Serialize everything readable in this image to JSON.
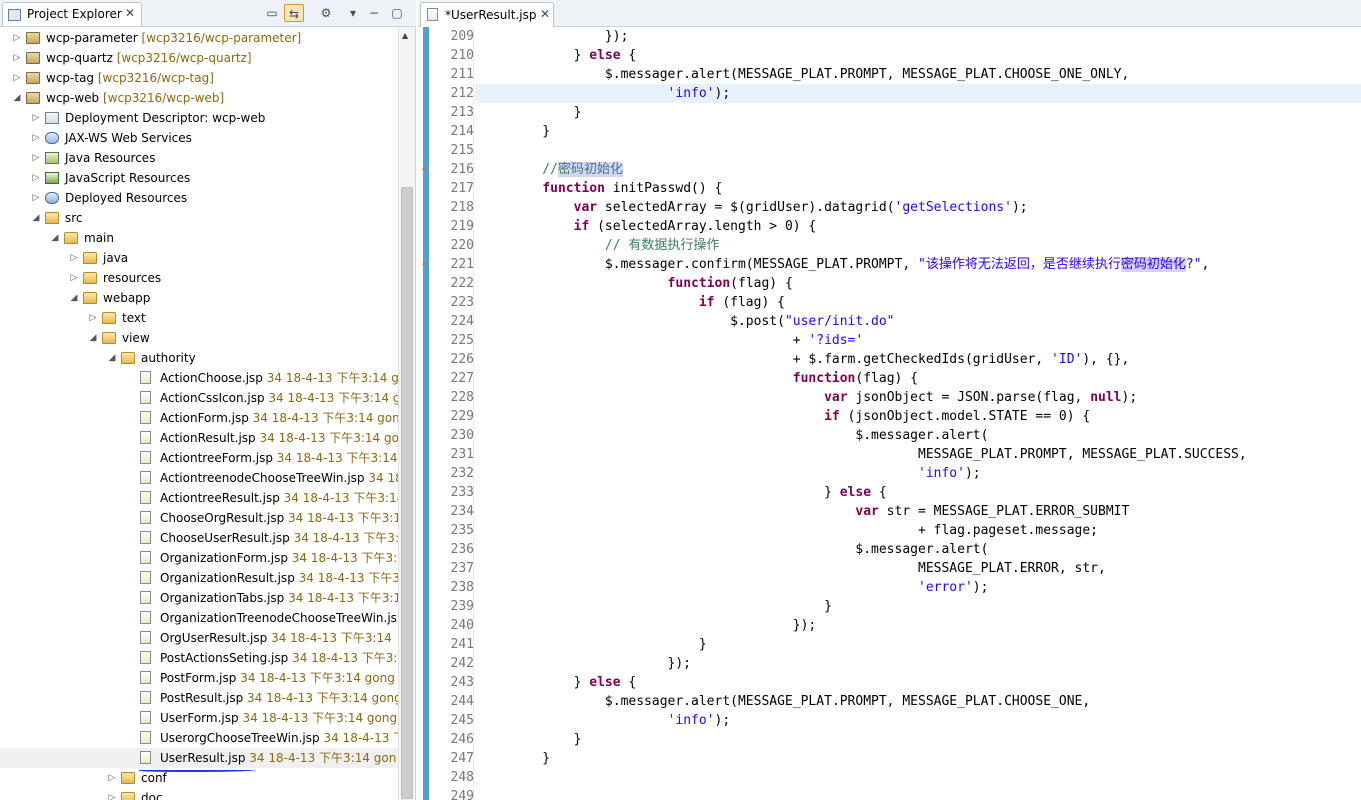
{
  "explorer": {
    "tab_title": "Project Explorer",
    "tab_close": "✕",
    "tools": [
      "▭",
      "⇆",
      "⚙",
      "▾",
      "−",
      "▢"
    ],
    "items": [
      {
        "depth": 0,
        "twisty": "▷",
        "icon": "project",
        "label": "wcp-parameter",
        "dec": "[wcp3216/wcp-parameter]"
      },
      {
        "depth": 0,
        "twisty": "▷",
        "icon": "project",
        "label": "wcp-quartz",
        "dec": "[wcp3216/wcp-quartz]"
      },
      {
        "depth": 0,
        "twisty": "▷",
        "icon": "project",
        "label": "wcp-tag",
        "dec": "[wcp3216/wcp-tag]"
      },
      {
        "depth": 0,
        "twisty": "◢",
        "icon": "project",
        "label": "wcp-web",
        "dec": "[wcp3216/wcp-web]"
      },
      {
        "depth": 1,
        "twisty": "▷",
        "icon": "desc",
        "label": "Deployment Descriptor: wcp-web",
        "dec": ""
      },
      {
        "depth": 1,
        "twisty": "▷",
        "icon": "ws",
        "label": "JAX-WS Web Services",
        "dec": ""
      },
      {
        "depth": 1,
        "twisty": "▷",
        "icon": "java",
        "label": "Java Resources",
        "dec": ""
      },
      {
        "depth": 1,
        "twisty": "▷",
        "icon": "js",
        "label": "JavaScript Resources",
        "dec": ""
      },
      {
        "depth": 1,
        "twisty": "▷",
        "icon": "deploy",
        "label": "Deployed Resources",
        "dec": ""
      },
      {
        "depth": 1,
        "twisty": "◢",
        "icon": "folder",
        "label": "src",
        "dec": ""
      },
      {
        "depth": 2,
        "twisty": "◢",
        "icon": "folder",
        "label": "main",
        "dec": ""
      },
      {
        "depth": 3,
        "twisty": "▷",
        "icon": "folder",
        "label": "java",
        "dec": ""
      },
      {
        "depth": 3,
        "twisty": "▷",
        "icon": "folder",
        "label": "resources",
        "dec": ""
      },
      {
        "depth": 3,
        "twisty": "◢",
        "icon": "folder",
        "label": "webapp",
        "dec": ""
      },
      {
        "depth": 4,
        "twisty": "▷",
        "icon": "folder",
        "label": "text",
        "dec": ""
      },
      {
        "depth": 4,
        "twisty": "◢",
        "icon": "folder",
        "label": "view",
        "dec": ""
      },
      {
        "depth": 5,
        "twisty": "◢",
        "icon": "folder",
        "label": "authority",
        "dec": ""
      },
      {
        "depth": 6,
        "twisty": "",
        "icon": "file",
        "label": "ActionChoose.jsp",
        "dec": "34  18-4-13 下午3:14  gong"
      },
      {
        "depth": 6,
        "twisty": "",
        "icon": "file",
        "label": "ActionCssIcon.jsp",
        "dec": "34  18-4-13 下午3:14  go"
      },
      {
        "depth": 6,
        "twisty": "",
        "icon": "file",
        "label": "ActionForm.jsp",
        "dec": "34  18-4-13 下午3:14  gong"
      },
      {
        "depth": 6,
        "twisty": "",
        "icon": "file",
        "label": "ActionResult.jsp",
        "dec": "34  18-4-13 下午3:14  gon"
      },
      {
        "depth": 6,
        "twisty": "",
        "icon": "file",
        "label": "ActiontreeForm.jsp",
        "dec": "34  18-4-13 下午3:14"
      },
      {
        "depth": 6,
        "twisty": "",
        "icon": "file",
        "label": "ActiontreenodeChooseTreeWin.jsp",
        "dec": "34  18-4"
      },
      {
        "depth": 6,
        "twisty": "",
        "icon": "file",
        "label": "ActiontreeResult.jsp",
        "dec": "34  18-4-13 下午3:14"
      },
      {
        "depth": 6,
        "twisty": "",
        "icon": "file",
        "label": "ChooseOrgResult.jsp",
        "dec": "34  18-4-13 下午3:14"
      },
      {
        "depth": 6,
        "twisty": "",
        "icon": "file",
        "label": "ChooseUserResult.jsp",
        "dec": "34  18-4-13 下午3:14"
      },
      {
        "depth": 6,
        "twisty": "",
        "icon": "file",
        "label": "OrganizationForm.jsp",
        "dec": "34  18-4-13 下午3:14"
      },
      {
        "depth": 6,
        "twisty": "",
        "icon": "file",
        "label": "OrganizationResult.jsp",
        "dec": "34  18-4-13 下午3:14"
      },
      {
        "depth": 6,
        "twisty": "",
        "icon": "file",
        "label": "OrganizationTabs.jsp",
        "dec": "34  18-4-13 下午3:14"
      },
      {
        "depth": 6,
        "twisty": "",
        "icon": "file",
        "label": "OrganizationTreenodeChooseTreeWin.jsp",
        "dec": ""
      },
      {
        "depth": 6,
        "twisty": "",
        "icon": "file",
        "label": "OrgUserResult.jsp",
        "dec": "34  18-4-13 下午3:14"
      },
      {
        "depth": 6,
        "twisty": "",
        "icon": "file",
        "label": "PostActionsSeting.jsp",
        "dec": "34  18-4-13 下午3:14"
      },
      {
        "depth": 6,
        "twisty": "",
        "icon": "file",
        "label": "PostForm.jsp",
        "dec": "34  18-4-13 下午3:14  gong"
      },
      {
        "depth": 6,
        "twisty": "",
        "icon": "file",
        "label": "PostResult.jsp",
        "dec": "34  18-4-13 下午3:14  gong"
      },
      {
        "depth": 6,
        "twisty": "",
        "icon": "file",
        "label": "UserForm.jsp",
        "dec": "34  18-4-13 下午3:14  gong"
      },
      {
        "depth": 6,
        "twisty": "",
        "icon": "file",
        "label": "UserorgChooseTreeWin.jsp",
        "dec": "34  18-4-13 下"
      },
      {
        "depth": 6,
        "twisty": "",
        "icon": "file",
        "label": "UserResult.jsp",
        "dec": "34  18-4-13 下午3:14  gon",
        "selected": true
      },
      {
        "depth": 5,
        "twisty": "▷",
        "icon": "folder",
        "label": "conf",
        "dec": ""
      },
      {
        "depth": 5,
        "twisty": "▷",
        "icon": "folder",
        "label": "doc",
        "dec": ""
      }
    ]
  },
  "editor": {
    "tab_title": "*UserResult.jsp",
    "tab_close": "✕",
    "marker_glyph": "⇨",
    "markers": [
      7,
      12
    ],
    "current_line_index": 3,
    "lines": [
      {
        "num": "209",
        "segs": [
          {
            "t": "            });",
            "c": ""
          }
        ]
      },
      {
        "num": "210",
        "segs": [
          {
            "t": "        } ",
            "c": ""
          },
          {
            "t": "else",
            "c": "kw"
          },
          {
            "t": " {",
            "c": ""
          }
        ]
      },
      {
        "num": "211",
        "segs": [
          {
            "t": "            $.messager.alert(MESSAGE_PLAT.PROMPT, MESSAGE_PLAT.CHOOSE_ONE_ONLY,",
            "c": ""
          }
        ]
      },
      {
        "num": "212",
        "segs": [
          {
            "t": "                    ",
            "c": ""
          },
          {
            "t": "'info'",
            "c": "str"
          },
          {
            "t": ");",
            "c": ""
          }
        ]
      },
      {
        "num": "213",
        "segs": [
          {
            "t": "        }",
            "c": ""
          }
        ]
      },
      {
        "num": "214",
        "segs": [
          {
            "t": "    }",
            "c": ""
          }
        ]
      },
      {
        "num": "215",
        "segs": [
          {
            "t": "",
            "c": ""
          }
        ]
      },
      {
        "num": "216",
        "segs": [
          {
            "t": "    //",
            "c": "cmt"
          },
          {
            "t": "密码初始化",
            "c": "cmt hl"
          }
        ]
      },
      {
        "num": "217",
        "segs": [
          {
            "t": "    ",
            "c": ""
          },
          {
            "t": "function",
            "c": "kw"
          },
          {
            "t": " initPasswd() {",
            "c": ""
          }
        ]
      },
      {
        "num": "218",
        "segs": [
          {
            "t": "        ",
            "c": ""
          },
          {
            "t": "var",
            "c": "kw"
          },
          {
            "t": " selectedArray = $(gridUser).datagrid(",
            "c": ""
          },
          {
            "t": "'getSelections'",
            "c": "str"
          },
          {
            "t": ");",
            "c": ""
          }
        ]
      },
      {
        "num": "219",
        "segs": [
          {
            "t": "        ",
            "c": ""
          },
          {
            "t": "if",
            "c": "kw"
          },
          {
            "t": " (selectedArray.length > 0) {",
            "c": ""
          }
        ]
      },
      {
        "num": "220",
        "segs": [
          {
            "t": "            // 有数据执行操作",
            "c": "cmt"
          }
        ]
      },
      {
        "num": "221",
        "segs": [
          {
            "t": "            $.messager.confirm(MESSAGE_PLAT.PROMPT, ",
            "c": ""
          },
          {
            "t": "\"该操作将无法返回，是否继续执行",
            "c": "str"
          },
          {
            "t": "密码初始化",
            "c": "str hl"
          },
          {
            "t": "?\"",
            "c": "str"
          },
          {
            "t": ",",
            "c": ""
          }
        ]
      },
      {
        "num": "222",
        "segs": [
          {
            "t": "                    ",
            "c": ""
          },
          {
            "t": "function",
            "c": "kw"
          },
          {
            "t": "(flag) {",
            "c": ""
          }
        ]
      },
      {
        "num": "223",
        "segs": [
          {
            "t": "                        ",
            "c": ""
          },
          {
            "t": "if",
            "c": "kw"
          },
          {
            "t": " (flag) {",
            "c": ""
          }
        ]
      },
      {
        "num": "224",
        "segs": [
          {
            "t": "                            $.post(",
            "c": ""
          },
          {
            "t": "\"user/init.do\"",
            "c": "str"
          }
        ]
      },
      {
        "num": "225",
        "segs": [
          {
            "t": "                                    + ",
            "c": ""
          },
          {
            "t": "'?ids='",
            "c": "str"
          }
        ]
      },
      {
        "num": "226",
        "segs": [
          {
            "t": "                                    + $.farm.getCheckedIds(gridUser, ",
            "c": ""
          },
          {
            "t": "'ID'",
            "c": "str"
          },
          {
            "t": "), {},",
            "c": ""
          }
        ]
      },
      {
        "num": "227",
        "segs": [
          {
            "t": "                                    ",
            "c": ""
          },
          {
            "t": "function",
            "c": "kw"
          },
          {
            "t": "(flag) {",
            "c": ""
          }
        ]
      },
      {
        "num": "228",
        "segs": [
          {
            "t": "                                        ",
            "c": ""
          },
          {
            "t": "var",
            "c": "kw"
          },
          {
            "t": " jsonObject = JSON.parse(flag, ",
            "c": ""
          },
          {
            "t": "null",
            "c": "kw"
          },
          {
            "t": ");",
            "c": ""
          }
        ]
      },
      {
        "num": "229",
        "segs": [
          {
            "t": "                                        ",
            "c": ""
          },
          {
            "t": "if",
            "c": "kw"
          },
          {
            "t": " (jsonObject.model.STATE == 0) {",
            "c": ""
          }
        ]
      },
      {
        "num": "230",
        "segs": [
          {
            "t": "                                            $.messager.alert(",
            "c": ""
          }
        ]
      },
      {
        "num": "231",
        "segs": [
          {
            "t": "                                                    MESSAGE_PLAT.PROMPT, MESSAGE_PLAT.SUCCESS,",
            "c": ""
          }
        ]
      },
      {
        "num": "232",
        "segs": [
          {
            "t": "                                                    ",
            "c": ""
          },
          {
            "t": "'info'",
            "c": "str"
          },
          {
            "t": ");",
            "c": ""
          }
        ]
      },
      {
        "num": "233",
        "segs": [
          {
            "t": "                                        } ",
            "c": ""
          },
          {
            "t": "else",
            "c": "kw"
          },
          {
            "t": " {",
            "c": ""
          }
        ]
      },
      {
        "num": "234",
        "segs": [
          {
            "t": "                                            ",
            "c": ""
          },
          {
            "t": "var",
            "c": "kw"
          },
          {
            "t": " str = MESSAGE_PLAT.ERROR_SUBMIT",
            "c": ""
          }
        ]
      },
      {
        "num": "235",
        "segs": [
          {
            "t": "                                                    + flag.pageset.message;",
            "c": ""
          }
        ]
      },
      {
        "num": "236",
        "segs": [
          {
            "t": "                                            $.messager.alert(",
            "c": ""
          }
        ]
      },
      {
        "num": "237",
        "segs": [
          {
            "t": "                                                    MESSAGE_PLAT.ERROR, str,",
            "c": ""
          }
        ]
      },
      {
        "num": "238",
        "segs": [
          {
            "t": "                                                    ",
            "c": ""
          },
          {
            "t": "'error'",
            "c": "str"
          },
          {
            "t": ");",
            "c": ""
          }
        ]
      },
      {
        "num": "239",
        "segs": [
          {
            "t": "                                        }",
            "c": ""
          }
        ]
      },
      {
        "num": "240",
        "segs": [
          {
            "t": "                                    });",
            "c": ""
          }
        ]
      },
      {
        "num": "241",
        "segs": [
          {
            "t": "                        }",
            "c": ""
          }
        ]
      },
      {
        "num": "242",
        "segs": [
          {
            "t": "                    });",
            "c": ""
          }
        ]
      },
      {
        "num": "243",
        "segs": [
          {
            "t": "        } ",
            "c": ""
          },
          {
            "t": "else",
            "c": "kw"
          },
          {
            "t": " {",
            "c": ""
          }
        ]
      },
      {
        "num": "244",
        "segs": [
          {
            "t": "            $.messager.alert(MESSAGE_PLAT.PROMPT, MESSAGE_PLAT.CHOOSE_ONE,",
            "c": ""
          }
        ]
      },
      {
        "num": "245",
        "segs": [
          {
            "t": "                    ",
            "c": ""
          },
          {
            "t": "'info'",
            "c": "str"
          },
          {
            "t": ");",
            "c": ""
          }
        ]
      },
      {
        "num": "246",
        "segs": [
          {
            "t": "        }",
            "c": ""
          }
        ]
      },
      {
        "num": "247",
        "segs": [
          {
            "t": "    }",
            "c": ""
          }
        ]
      },
      {
        "num": "248",
        "segs": [
          {
            "t": "",
            "c": ""
          }
        ]
      },
      {
        "num": "249",
        "segs": [
          {
            "t": "",
            "c": ""
          }
        ]
      }
    ]
  }
}
